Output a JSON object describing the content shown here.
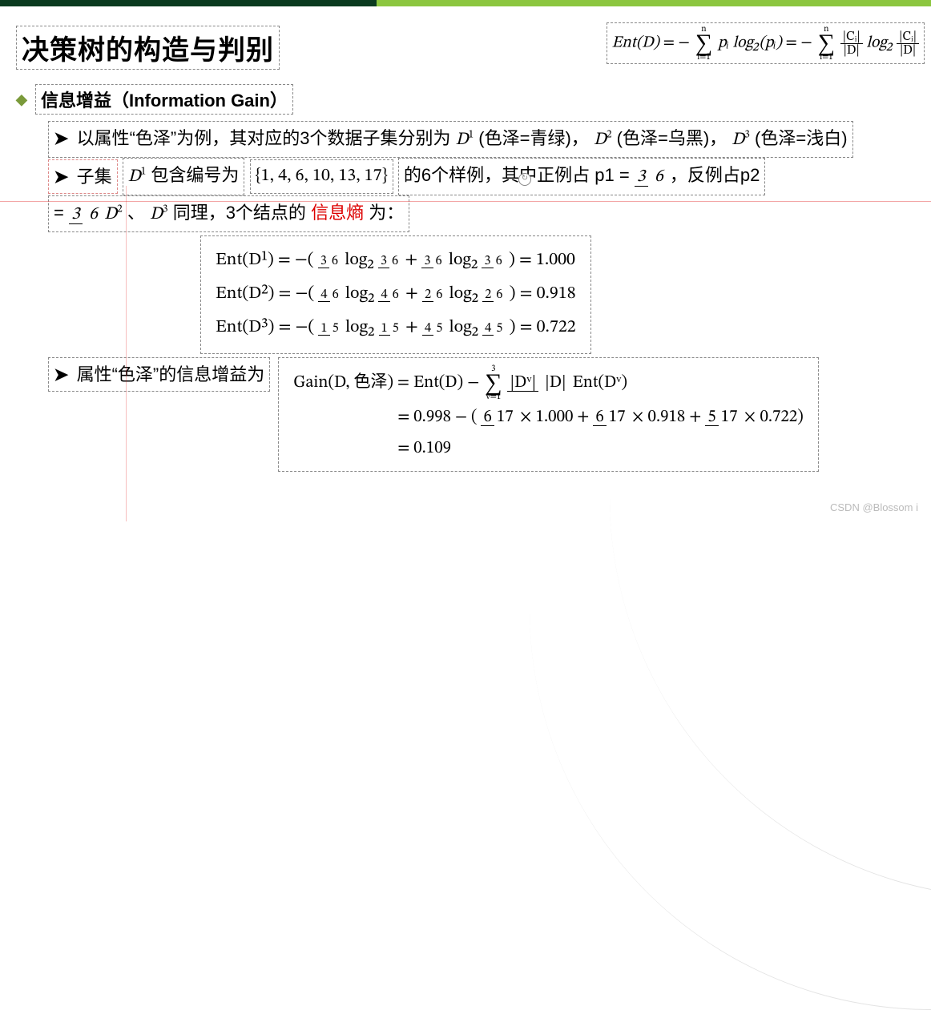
{
  "title": "决策树的构造与判别",
  "top_formula": {
    "lhs": "Ent(D)",
    "eq1_leading": "= −",
    "sigma1": {
      "over": "n",
      "under": "i=1"
    },
    "eq1_term": "pᵢ log₂(pᵢ)",
    "eq2_leading": "= −",
    "sigma2": {
      "over": "n",
      "under": "i=1"
    },
    "eq2_frac1": {
      "num": "|Cᵢ|",
      "den": "|D|"
    },
    "eq2_mid": " log₂ ",
    "eq2_frac2": {
      "num": "|Cᵢ|",
      "den": "|D|"
    }
  },
  "heading2": {
    "bullet": "◆",
    "label": "信息增益（Information Gain）"
  },
  "line1": {
    "bullet": "➤",
    "t1": "以属性“色泽”为例，其对应的3个数据子集分别为",
    "d1": "D",
    "d1sup": "1",
    "t2": "(色泽=青绿)，",
    "d2": "D",
    "d2sup": "2",
    "t3": " (色泽=乌黑)，",
    "d3": "D",
    "d3sup": "3",
    "t4": " (色泽=浅白)"
  },
  "line2": {
    "bullet": "➤",
    "t1_a": "子集 ",
    "t1_b": "D",
    "t1_bsup": "1",
    "t1_c": "包含编号为",
    "set": "{1, 4, 6, 10, 13, 17}",
    "t2": " 的6个样例，其中正例占 p1 =",
    "frac1": {
      "num": "3",
      "den": "6"
    },
    "t3": "，反例占p2",
    "t4": "=",
    "frac2": {
      "num": "3",
      "den": "6"
    },
    "t5_a": " ",
    "t5_d2": "D",
    "t5_d2sup": "2",
    "t5_b": "、",
    "t5_d3": "D",
    "t5_d3sup": "3",
    "t5_c": "同理，3个结点的",
    "t5_red": "信息熵",
    "t5_d": "为："
  },
  "entbox": {
    "row1": {
      "lhs": "Ent(D¹) = −(",
      "f1": {
        "num": "3",
        "den": "6"
      },
      "mid1": " log₂",
      "f2": {
        "num": "3",
        "den": "6"
      },
      "plus": " + ",
      "f3": {
        "num": "3",
        "den": "6"
      },
      "mid2": " log₂",
      "f4": {
        "num": "3",
        "den": "6"
      },
      "rhs": ") = 1.000"
    },
    "row2": {
      "lhs": "Ent(D²) = −(",
      "f1": {
        "num": "4",
        "den": "6"
      },
      "mid1": " log₂",
      "f2": {
        "num": "4",
        "den": "6"
      },
      "plus": " + ",
      "f3": {
        "num": "2",
        "den": "6"
      },
      "mid2": " log₂",
      "f4": {
        "num": "2",
        "den": "6"
      },
      "rhs": ") = 0.918"
    },
    "row3": {
      "lhs": "Ent(D³) = −(",
      "f1": {
        "num": "1",
        "den": "5"
      },
      "mid1": " log₂",
      "f2": {
        "num": "1",
        "den": "5"
      },
      "plus": " + ",
      "f3": {
        "num": "4",
        "den": "5"
      },
      "mid2": " log₂",
      "f4": {
        "num": "4",
        "den": "5"
      },
      "rhs": ") = 0.722"
    }
  },
  "line3": {
    "bullet": "➤",
    "text": "属性“色泽”的信息增益为"
  },
  "gainbox": {
    "r1_a": "Gain(D, 色泽) = Ent(D) − ",
    "sigma": {
      "over": "3",
      "under": "v=1"
    },
    "r1_frac": {
      "num": "|Dᵛ|",
      "den": "|D|"
    },
    "r1_b": "Ent(Dᵛ)",
    "r2_a": "= 0.998 − (",
    "r2_f1": {
      "num": "6",
      "den": "17"
    },
    "r2_m1": " × 1.000 + ",
    "r2_f2": {
      "num": "6",
      "den": "17"
    },
    "r2_m2": " × 0.918 + ",
    "r2_f3": {
      "num": "5",
      "den": "17"
    },
    "r2_m3": " × 0.722)",
    "r3": "= 0.109"
  },
  "watermark": "CSDN @Blossom i"
}
